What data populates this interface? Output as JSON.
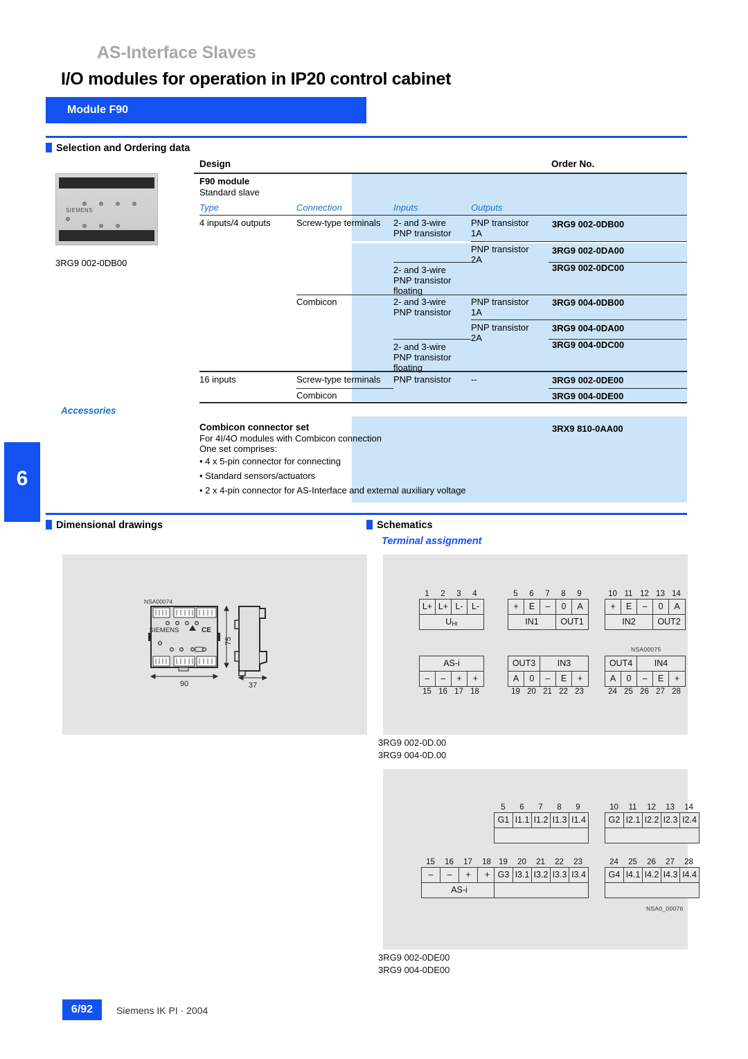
{
  "header": {
    "eyebrow": "AS-Interface Slaves",
    "title": "I/O modules for operation in IP20 control cabinet",
    "module_bar": "Module F90"
  },
  "tab_marker": "6",
  "sections": {
    "selection": "Selection and Ordering data",
    "dimensional": "Dimensional drawings",
    "schematics": "Schematics",
    "terminal_assignment": "Terminal assignment"
  },
  "photo": {
    "brand": "SIEMENS",
    "caption": "3RG9 002-0DB00"
  },
  "table": {
    "col_design": "Design",
    "col_order": "Order No.",
    "group_title": "F90 module",
    "group_sub": "Standard slave",
    "sub_headers": {
      "type": "Type",
      "connection": "Connection",
      "inputs": "Inputs",
      "outputs": "Outputs"
    },
    "rows": [
      {
        "type": "4 inputs/4 outputs",
        "connection": "Screw-type terminals",
        "inputs": "2- and 3-wire\nPNP transistor",
        "outputs": "PNP transistor\n1A",
        "order": "3RG9 002-0DB00"
      },
      {
        "type": "",
        "connection": "",
        "inputs": "",
        "outputs": "PNP transistor\n2A",
        "order": "3RG9 002-0DA00"
      },
      {
        "type": "",
        "connection": "",
        "inputs": "2- and 3-wire\nPNP transistor\nfloating",
        "outputs": "",
        "order": "3RG9 002-0DC00"
      },
      {
        "type": "",
        "connection": "Combicon",
        "inputs": "2- and 3-wire\nPNP transistor",
        "outputs": "PNP transistor\n1A",
        "order": "3RG9 004-0DB00"
      },
      {
        "type": "",
        "connection": "",
        "inputs": "",
        "outputs": "PNP transistor\n2A",
        "order": "3RG9 004-0DA00"
      },
      {
        "type": "",
        "connection": "",
        "inputs": "2- and 3-wire\nPNP transistor\nfloating",
        "outputs": "",
        "order": "3RG9 004-0DC00"
      },
      {
        "type": "16 inputs",
        "connection": "Screw-type terminals",
        "inputs": "PNP transistor",
        "outputs": "--",
        "order": "3RG9 002-0DE00"
      },
      {
        "type": "",
        "connection": "Combicon",
        "inputs": "",
        "outputs": "",
        "order": "3RG9 004-0DE00"
      }
    ]
  },
  "accessories": {
    "heading": "Accessories",
    "title": "Combicon connector set",
    "line1": "For 4I/4O modules with Combicon connection",
    "line2": "One set comprises:",
    "bullets": [
      "4 x 5-pin connector for connecting",
      "Standard sensors/actuators",
      "2 x 4-pin connector for AS-Interface and external auxiliary voltage"
    ],
    "order": "3RX9 810-0AA00"
  },
  "dimensional_drawing": {
    "tag": "NSA00074",
    "brand": "SIEMENS",
    "width_mm": "90",
    "height_mm": "75",
    "depth_mm": "37"
  },
  "schematic1": {
    "tag": "NSA00075",
    "caption_line1": "3RG9 002-0D.00",
    "caption_line2": "3RG9 004-0D.00",
    "blocks": [
      {
        "numbers": [
          "1",
          "2",
          "3",
          "4"
        ],
        "cells": [
          "L+",
          "L+",
          "L-",
          "L-"
        ],
        "labels": [
          {
            "text": "U",
            "sub": "HI",
            "span": 4
          }
        ],
        "nums_on_top": true
      },
      {
        "numbers": [
          "5",
          "6",
          "7",
          "8",
          "9"
        ],
        "cells": [
          "+",
          "E",
          "–",
          "0",
          "A"
        ],
        "labels": [
          {
            "text": "IN1",
            "span": 3
          },
          {
            "text": "OUT1",
            "span": 2
          }
        ],
        "nums_on_top": true
      },
      {
        "numbers": [
          "10",
          "11",
          "12",
          "13",
          "14"
        ],
        "cells": [
          "+",
          "E",
          "–",
          "0",
          "A"
        ],
        "labels": [
          {
            "text": "IN2",
            "span": 3
          },
          {
            "text": "OUT2",
            "span": 2
          }
        ],
        "nums_on_top": true
      },
      {
        "numbers": [
          "15",
          "16",
          "17",
          "18"
        ],
        "cells": [
          "–",
          "–",
          "+",
          "+"
        ],
        "labels": [
          {
            "text": "AS-i",
            "span": 4
          }
        ],
        "nums_on_top": false
      },
      {
        "numbers": [
          "19",
          "20",
          "21",
          "22",
          "23"
        ],
        "cells": [
          "A",
          "0",
          "–",
          "E",
          "+"
        ],
        "labels": [
          {
            "text": "OUT3",
            "span": 2
          },
          {
            "text": "IN3",
            "span": 3
          }
        ],
        "nums_on_top": false
      },
      {
        "numbers": [
          "24",
          "25",
          "26",
          "27",
          "28"
        ],
        "cells": [
          "A",
          "0",
          "–",
          "E",
          "+"
        ],
        "labels": [
          {
            "text": "OUT4",
            "span": 2
          },
          {
            "text": "IN4",
            "span": 3
          }
        ],
        "nums_on_top": false
      }
    ]
  },
  "schematic2": {
    "tag": "NSA0_00076",
    "caption_line1": "3RG9 002-0DE00",
    "caption_line2": "3RG9 004-0DE00",
    "blocks": [
      {
        "numbers": [
          "5",
          "6",
          "7",
          "8",
          "9"
        ],
        "cells": [
          "G1",
          "I1.1",
          "I1.2",
          "I1.3",
          "I1.4"
        ]
      },
      {
        "numbers": [
          "10",
          "11",
          "12",
          "13",
          "14"
        ],
        "cells": [
          "G2",
          "I2.1",
          "I2.2",
          "I2.3",
          "I2.4"
        ]
      },
      {
        "numbers": [
          "15",
          "16",
          "17",
          "18"
        ],
        "cells": [
          "–",
          "–",
          "+",
          "+"
        ],
        "label": "AS-i"
      },
      {
        "numbers": [
          "19",
          "20",
          "21",
          "22",
          "23"
        ],
        "cells": [
          "G3",
          "I3.1",
          "I3.2",
          "I3.3",
          "I3.4"
        ]
      },
      {
        "numbers": [
          "24",
          "25",
          "26",
          "27",
          "28"
        ],
        "cells": [
          "G4",
          "I4.1",
          "I4.2",
          "I4.3",
          "I4.4"
        ]
      }
    ]
  },
  "footer": {
    "page": "6/92",
    "source": "Siemens IK PI · 2004"
  },
  "colors": {
    "brand_blue": "#1351f0",
    "order_cell_blue": "#cbe4f7",
    "panel_grey": "#e4e4e4",
    "eyebrow_grey": "#a8a8a8"
  }
}
